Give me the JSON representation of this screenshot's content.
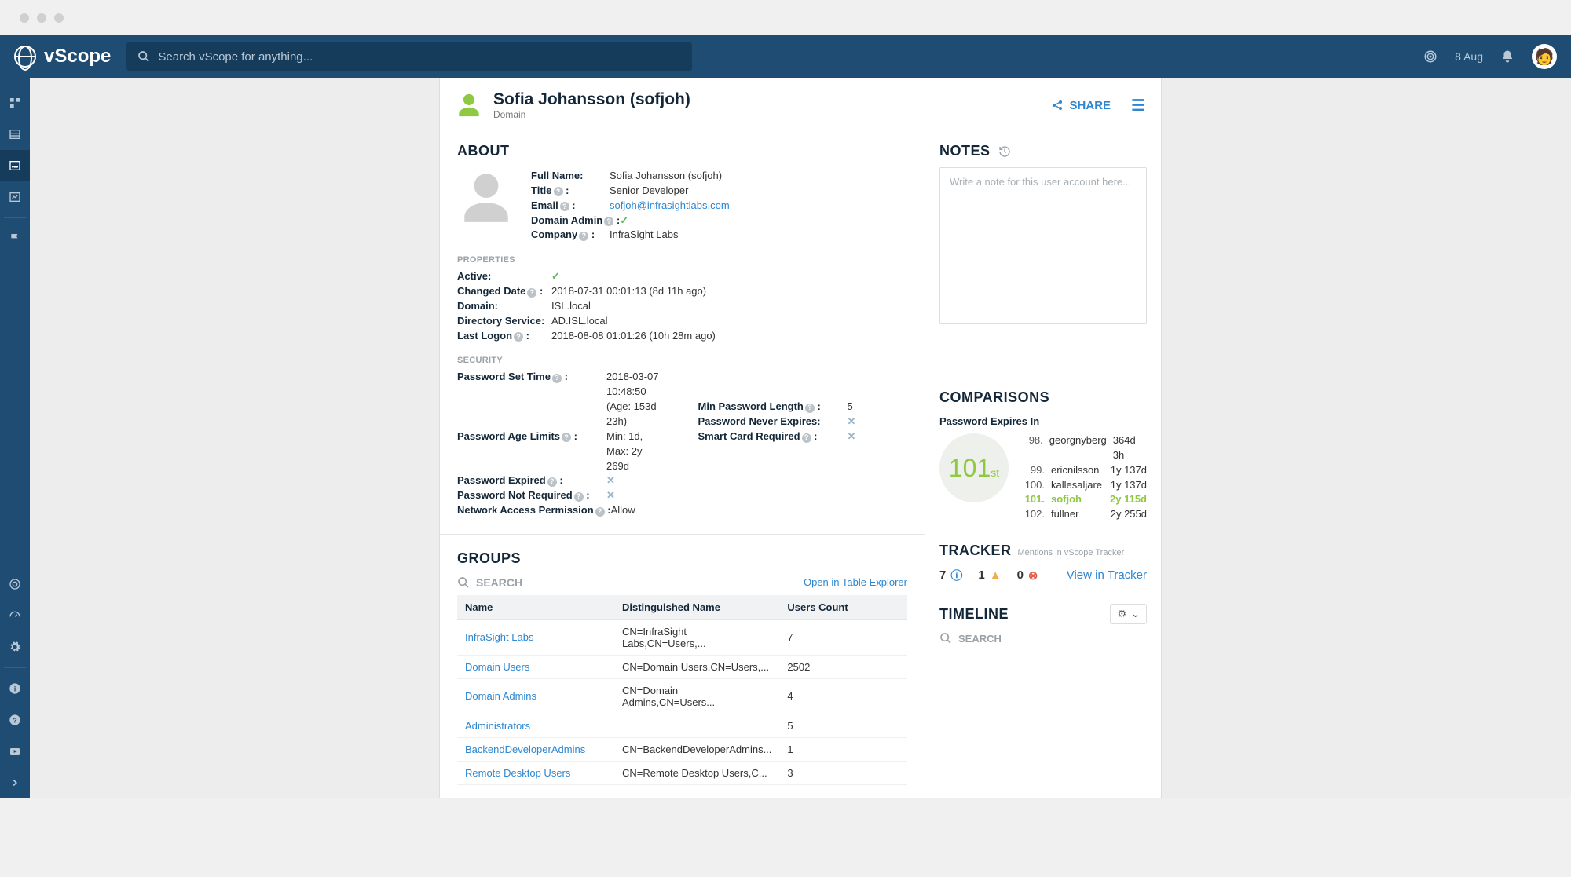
{
  "app": {
    "name": "vScope",
    "date": "8 Aug"
  },
  "search": {
    "placeholder": "Search vScope for anything..."
  },
  "header": {
    "title": "Sofia Johansson (sofjoh)",
    "subtitle": "Domain",
    "share": "SHARE"
  },
  "about": {
    "heading": "ABOUT",
    "fields": {
      "full_name_label": "Full Name:",
      "full_name": "Sofia Johansson (sofjoh)",
      "title_label": "Title",
      "title": "Senior Developer",
      "email_label": "Email",
      "email": "sofjoh@infrasightlabs.com",
      "domain_admin_label": "Domain Admin",
      "company_label": "Company",
      "company": "InfraSight Labs"
    }
  },
  "properties": {
    "heading": "PROPERTIES",
    "active_label": "Active:",
    "changed_date_label": "Changed Date",
    "changed_date": "2018-07-31 00:01:13 (8d 11h ago)",
    "domain_label": "Domain:",
    "domain": "ISL.local",
    "dir_service_label": "Directory Service:",
    "dir_service": "AD.ISL.local",
    "last_logon_label": "Last Logon",
    "last_logon": "2018-08-08 01:01:26 (10h 28m ago)"
  },
  "security": {
    "heading": "SECURITY",
    "password_set_label": "Password Set Time",
    "password_set": "2018-03-07 10:48:50 (Age: 153d 23h)",
    "age_limits_label": "Password Age Limits",
    "age_limits": "Min: 1d, Max: 2y 269d",
    "expired_label": "Password Expired",
    "not_required_label": "Password Not Required",
    "network_access_label": "Network Access Permission",
    "network_access": "Allow",
    "min_length_label": "Min Password Length",
    "min_length": "5",
    "never_expires_label": "Password Never Expires:",
    "smart_card_label": "Smart Card Required"
  },
  "groups": {
    "heading": "GROUPS",
    "search_label": "SEARCH",
    "open_explorer": "Open in Table Explorer",
    "columns": {
      "name": "Name",
      "dn": "Distinguished Name",
      "count": "Users Count"
    },
    "rows": [
      {
        "name": "InfraSight Labs",
        "dn": "CN=InfraSight Labs,CN=Users,...",
        "count": "7"
      },
      {
        "name": "Domain Users",
        "dn": "CN=Domain Users,CN=Users,...",
        "count": "2502"
      },
      {
        "name": "Domain Admins",
        "dn": "CN=Domain Admins,CN=Users...",
        "count": "4"
      },
      {
        "name": "Administrators",
        "dn": "",
        "count": "5"
      },
      {
        "name": "BackendDeveloperAdmins",
        "dn": "CN=BackendDeveloperAdmins...",
        "count": "1"
      },
      {
        "name": "Remote Desktop Users",
        "dn": "CN=Remote Desktop Users,C...",
        "count": "3"
      }
    ]
  },
  "notes": {
    "heading": "NOTES",
    "placeholder": "Write a note for this user account here..."
  },
  "comparisons": {
    "heading": "COMPARISONS",
    "metric": "Password Expires In",
    "rank": "101",
    "rank_suffix": "st",
    "list": [
      {
        "idx": "98.",
        "name": "georgnyberg",
        "val": "364d 3h",
        "hl": false
      },
      {
        "idx": "99.",
        "name": "ericnilsson",
        "val": "1y 137d",
        "hl": false
      },
      {
        "idx": "100.",
        "name": "kallesaljare",
        "val": "1y 137d",
        "hl": false
      },
      {
        "idx": "101.",
        "name": "sofjoh",
        "val": "2y 115d",
        "hl": true
      },
      {
        "idx": "102.",
        "name": "fullner",
        "val": "2y 255d",
        "hl": false
      }
    ]
  },
  "tracker": {
    "heading": "TRACKER",
    "sub": "Mentions in vScope Tracker",
    "info": "7",
    "warn": "1",
    "err": "0",
    "view": "View in Tracker"
  },
  "timeline": {
    "heading": "TIMELINE",
    "search": "SEARCH"
  }
}
